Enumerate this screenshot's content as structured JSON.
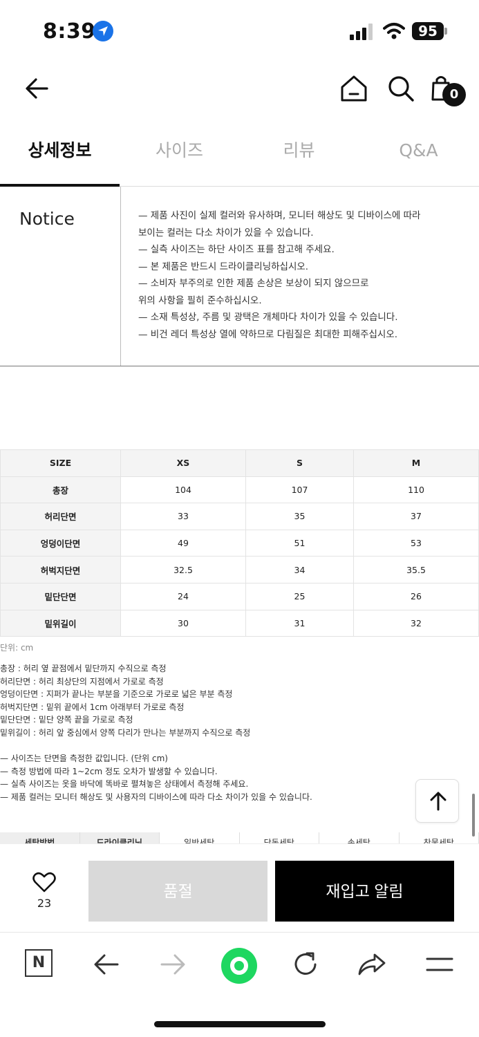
{
  "status_bar": {
    "time": "8:39",
    "battery": "95"
  },
  "header": {
    "cart_count": "0"
  },
  "tabs": [
    {
      "label": "상세정보",
      "active": true
    },
    {
      "label": "사이즈",
      "active": false
    },
    {
      "label": "리뷰",
      "active": false
    },
    {
      "label": "Q&A",
      "active": false
    }
  ],
  "notice": {
    "title": "Notice",
    "lines": [
      "— 제품 사진이 실제 컬러와 유사하며, 모니터 해상도 및 디바이스에 따라",
      "   보이는 컬러는 다소 차이가 있을 수 있습니다.",
      "— 실측 사이즈는 하단 사이즈 표를 참고해 주세요.",
      "— 본 제품은 반드시 드라이클리닝하십시오.",
      "— 소비자 부주의로 인한 제품 손상은 보상이 되지 않으므로",
      "   위의 사항을 필히 준수하십시오.",
      "— 소재 특성상, 주름 및 광택은 개체마다 차이가 있을 수 있습니다.",
      "— 비건 레더 특성상 열에 약하므로 다림질은 최대한 피해주십시오."
    ]
  },
  "size_table": {
    "headers": [
      "SIZE",
      "XS",
      "S",
      "M"
    ],
    "rows": [
      [
        "총장",
        "104",
        "107",
        "110"
      ],
      [
        "허리단면",
        "33",
        "35",
        "37"
      ],
      [
        "엉덩이단면",
        "49",
        "51",
        "53"
      ],
      [
        "허벅지단면",
        "32.5",
        "34",
        "35.5"
      ],
      [
        "밑단단면",
        "24",
        "25",
        "26"
      ],
      [
        "밑위길이",
        "30",
        "31",
        "32"
      ]
    ]
  },
  "unit_label": "단위: cm",
  "measure_notes": [
    "총장 : 허리 옆 끝점에서 밑단까지 수직으로 측정",
    "허리단면 : 허리 최상단의 지점에서 가로로 측정",
    "엉덩이단면 : 지퍼가 끝나는 부분을 기준으로 가로로 넓은 부분 측정",
    "허벅지단면 : 밑위 끝에서 1cm 아래부터 가로로 측정",
    "밑단단면 : 밑단 양쪽 끝을 가로로 측정",
    "밑위길이 : 허리 앞 중심에서 양쪽 다리가 만나는 부분까지 수직으로 측정"
  ],
  "size_notes": [
    "— 사이즈는 단면을 측정한 값입니다. (단위 cm)",
    "— 측정 방법에 따라 1~2cm 정도 오차가 발생할 수 있습니다.",
    "— 실측 사이즈는 옷을 바닥에 똑바로 펼쳐놓은 상태에서 측정해 주세요.",
    "— 제품 컬러는 모니터 해상도 및 사용자의 디바이스에 따라 다소 차이가 있을 수 있습니다."
  ],
  "care_row": [
    "세탁방법",
    "드라이클리닝",
    "일반세탁",
    "단독세탁",
    "손세탁",
    "찬물세탁"
  ],
  "buy_bar": {
    "like_count": "23",
    "soldout_label": "품절",
    "restock_label": "재입고 알림"
  },
  "toolbar": {
    "n_label": "N"
  },
  "colors": {
    "accent_green": "#1ed760",
    "sold_out_bg": "#d9d9d9",
    "restock_bg": "#000000"
  }
}
